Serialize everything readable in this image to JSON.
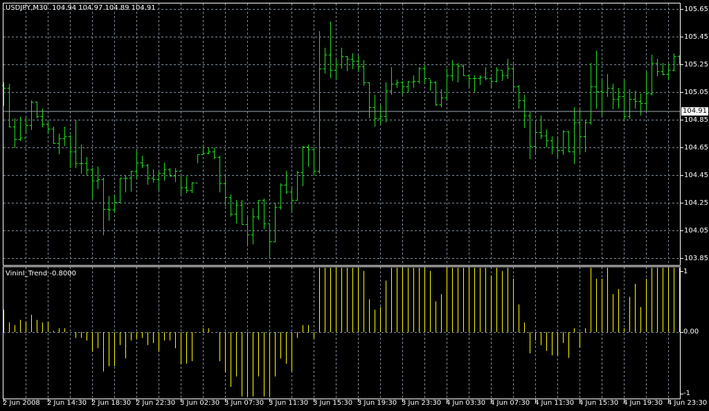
{
  "header": {
    "symbol": "USDJPY,M30",
    "ohlc": "104.94 104.97 104.89 104.91"
  },
  "indicator": {
    "title": "VininI_Trend -0.8000",
    "axis_labels": [
      "1",
      "0.00",
      "-1"
    ]
  },
  "colors": {
    "bars": "#22dd22",
    "histogram": "#ffff00",
    "grid": "#8090a0",
    "background": "#000000",
    "axis": "#ffffff"
  },
  "bid": {
    "value": 104.91,
    "label": "104.91"
  },
  "chart_data": [
    {
      "type": "ohlc",
      "title": "USDJPY,M30",
      "ylim": [
        103.81,
        105.7
      ],
      "y_ticks": [
        "105.65",
        "105.45",
        "105.25",
        "105.05",
        "104.85",
        "104.65",
        "104.45",
        "104.25",
        "104.05",
        "103.85"
      ],
      "x_tick_labels": [
        "2 Jun 2008",
        "2 Jun 14:30",
        "2 Jun 18:30",
        "2 Jun 22:30",
        "3 Jun 02:30",
        "3 Jun 07:30",
        "3 Jun 11:30",
        "3 Jun 15:30",
        "3 Jun 19:30",
        "3 Jun 23:30",
        "4 Jun 03:30",
        "4 Jun 07:30",
        "4 Jun 11:30",
        "4 Jun 15:30",
        "4 Jun 19:30",
        "4 Jun 23:30"
      ],
      "first_open": 105.1,
      "bars_hlc": [
        [
          105.12,
          104.955,
          105.08
        ],
        [
          105.11,
          104.8,
          104.8
        ],
        [
          104.86,
          104.65,
          104.71
        ],
        [
          104.87,
          104.7,
          104.72
        ],
        [
          104.865,
          104.76,
          104.81
        ],
        [
          104.99,
          104.78,
          104.98
        ],
        [
          104.98,
          104.865,
          104.875
        ],
        [
          104.93,
          104.8,
          104.82
        ],
        [
          104.835,
          104.755,
          104.785
        ],
        [
          104.8,
          104.68,
          104.68
        ],
        [
          104.75,
          104.605,
          104.715
        ],
        [
          104.8,
          104.665,
          104.73
        ],
        [
          104.74,
          104.505,
          104.62
        ],
        [
          104.85,
          104.505,
          104.535
        ],
        [
          104.67,
          104.465,
          104.535
        ],
        [
          104.58,
          104.455,
          104.49
        ],
        [
          104.5,
          104.285,
          104.41
        ],
        [
          104.51,
          104.355,
          104.42
        ],
        [
          104.43,
          104.02,
          104.205
        ],
        [
          104.3,
          104.125,
          104.2
        ],
        [
          104.305,
          104.185,
          104.255
        ],
        [
          104.43,
          104.255,
          104.43
        ],
        [
          104.45,
          104.33,
          104.43
        ],
        [
          104.48,
          104.335,
          104.48
        ],
        [
          104.625,
          104.43,
          104.54
        ],
        [
          104.59,
          104.505,
          104.52
        ],
        [
          104.53,
          104.385,
          104.43
        ],
        [
          104.49,
          104.4,
          104.42
        ],
        [
          104.475,
          104.345,
          104.465
        ],
        [
          104.54,
          104.415,
          104.49
        ],
        [
          104.5,
          104.445,
          104.445
        ],
        [
          104.5,
          104.405,
          104.48
        ],
        [
          104.445,
          104.315,
          104.36
        ],
        [
          104.44,
          104.325,
          104.34
        ],
        [
          104.4,
          104.325,
          104.395
        ],
        [
          104.6,
          104.54,
          104.6
        ],
        [
          104.66,
          104.605,
          104.61
        ],
        [
          104.65,
          104.605,
          104.62
        ],
        [
          104.65,
          104.57,
          104.58
        ],
        [
          104.59,
          104.33,
          104.39
        ],
        [
          104.45,
          104.23,
          104.29
        ],
        [
          104.31,
          104.155,
          104.17
        ],
        [
          104.27,
          104.105,
          104.235
        ],
        [
          104.27,
          104.095,
          104.095
        ],
        [
          104.145,
          103.955,
          104.02
        ],
        [
          104.21,
          103.955,
          104.15
        ],
        [
          104.27,
          104.13,
          104.27
        ],
        [
          104.28,
          104.065,
          104.1
        ],
        [
          104.09,
          103.865,
          103.97
        ],
        [
          104.25,
          103.97,
          104.22
        ],
        [
          104.39,
          104.205,
          104.38
        ],
        [
          104.48,
          104.32,
          104.33
        ],
        [
          104.36,
          104.195,
          104.27
        ],
        [
          104.48,
          104.27,
          104.47
        ],
        [
          104.66,
          104.375,
          104.655
        ],
        [
          104.67,
          104.515,
          104.635
        ],
        [
          104.65,
          104.45,
          104.48
        ],
        [
          105.49,
          104.465,
          105.22
        ],
        [
          105.37,
          105.19,
          105.32
        ],
        [
          105.56,
          105.155,
          105.21
        ],
        [
          105.285,
          105.145,
          105.25
        ],
        [
          105.37,
          105.225,
          105.31
        ],
        [
          105.31,
          105.205,
          105.29
        ],
        [
          105.33,
          105.22,
          105.275
        ],
        [
          105.315,
          105.205,
          105.235
        ],
        [
          105.28,
          105.1,
          105.12
        ],
        [
          105.12,
          104.865,
          104.94
        ],
        [
          105.03,
          104.805,
          104.86
        ],
        [
          104.955,
          104.825,
          104.875
        ],
        [
          105.12,
          104.835,
          105.06
        ],
        [
          105.23,
          105.035,
          105.11
        ],
        [
          105.14,
          105.085,
          105.12
        ],
        [
          105.13,
          105.035,
          105.09
        ],
        [
          105.13,
          105.055,
          105.125
        ],
        [
          105.17,
          105.085,
          105.13
        ],
        [
          105.23,
          105.115,
          105.22
        ],
        [
          105.245,
          105.12,
          105.15
        ],
        [
          105.14,
          105.065,
          105.12
        ],
        [
          105.13,
          104.955,
          104.96
        ],
        [
          105.07,
          104.945,
          105.01
        ],
        [
          105.22,
          105.0,
          105.17
        ],
        [
          105.28,
          105.135,
          105.25
        ],
        [
          105.26,
          105.125,
          105.24
        ],
        [
          105.25,
          105.17,
          105.17
        ],
        [
          105.18,
          105.095,
          105.15
        ],
        [
          105.17,
          105.055,
          105.15
        ],
        [
          105.17,
          105.105,
          105.16
        ],
        [
          105.23,
          105.14,
          105.15
        ],
        [
          105.16,
          105.095,
          105.13
        ],
        [
          105.23,
          105.125,
          105.21
        ],
        [
          105.205,
          105.135,
          105.17
        ],
        [
          105.29,
          105.15,
          105.22
        ],
        [
          105.255,
          105.065,
          105.09
        ],
        [
          105.1,
          104.935,
          104.99
        ],
        [
          105.03,
          104.795,
          104.88
        ],
        [
          104.905,
          104.57,
          104.66
        ],
        [
          104.84,
          104.615,
          104.76
        ],
        [
          104.88,
          104.715,
          104.735
        ],
        [
          104.78,
          104.655,
          104.7
        ],
        [
          104.73,
          104.605,
          104.65
        ],
        [
          104.715,
          104.58,
          104.63
        ],
        [
          104.775,
          104.6,
          104.765
        ],
        [
          104.77,
          104.62,
          104.62
        ],
        [
          104.94,
          104.535,
          104.83
        ],
        [
          104.925,
          104.605,
          104.73
        ],
        [
          104.85,
          104.62,
          104.83
        ],
        [
          105.26,
          104.82,
          105.09
        ],
        [
          105.35,
          104.935,
          105.055
        ],
        [
          105.135,
          104.885,
          105.05
        ],
        [
          105.18,
          105.02,
          105.08
        ],
        [
          105.11,
          104.93,
          105.0
        ],
        [
          105.08,
          104.935,
          105.02
        ],
        [
          105.14,
          104.855,
          104.875
        ],
        [
          105.07,
          104.86,
          105.0
        ],
        [
          105.06,
          104.935,
          104.985
        ],
        [
          105.04,
          104.885,
          104.97
        ],
        [
          105.2,
          104.915,
          105.04
        ],
        [
          105.32,
          105.03,
          105.26
        ],
        [
          105.29,
          105.17,
          105.2
        ],
        [
          105.26,
          105.175,
          105.18
        ],
        [
          105.255,
          105.145,
          105.21
        ],
        [
          105.33,
          105.205,
          105.31
        ],
        [
          105.315,
          105.25,
          105.25
        ]
      ]
    },
    {
      "type": "bar",
      "title": "VininI_Trend -0.8000",
      "ylim": [
        -1,
        1
      ],
      "values": [
        0.35,
        0.15,
        0.11,
        0.19,
        0.16,
        0.27,
        0.19,
        0.15,
        0.16,
        0.02,
        0.06,
        0.06,
        0,
        -0.09,
        -0.09,
        -0.13,
        -0.3,
        -0.25,
        -0.61,
        -0.53,
        -0.53,
        -0.2,
        -0.41,
        -0.13,
        -0.11,
        -0.09,
        -0.2,
        -0.17,
        -0.3,
        -0.13,
        -0.13,
        -0.25,
        -0.5,
        -0.49,
        -0.45,
        0,
        0.06,
        0.06,
        0,
        -0.45,
        -0.62,
        -0.85,
        -0.69,
        -1,
        -1,
        -1,
        -0.69,
        -1,
        -1,
        -0.69,
        -0.41,
        -0.49,
        -0.61,
        -0.09,
        0.11,
        0.11,
        -0.1,
        1,
        1,
        1,
        1,
        1,
        1,
        1,
        1,
        0.95,
        0.51,
        0.35,
        0.39,
        0.8,
        1,
        1,
        1,
        1,
        1,
        1,
        1,
        0.95,
        0.48,
        0.59,
        1,
        1,
        1,
        1,
        1,
        1,
        1,
        1,
        0.88,
        1,
        0.95,
        1,
        0.83,
        0.43,
        0.15,
        -0.33,
        -0.13,
        -0.2,
        -0.29,
        -0.36,
        -0.37,
        -0.17,
        -0.4,
        0.06,
        -0.24,
        0.06,
        1,
        0.83,
        0.83,
        1,
        0.59,
        0.67,
        0.06,
        0.55,
        0.75,
        0.39,
        0.83,
        1,
        1,
        1,
        1,
        1,
        1
      ]
    }
  ]
}
